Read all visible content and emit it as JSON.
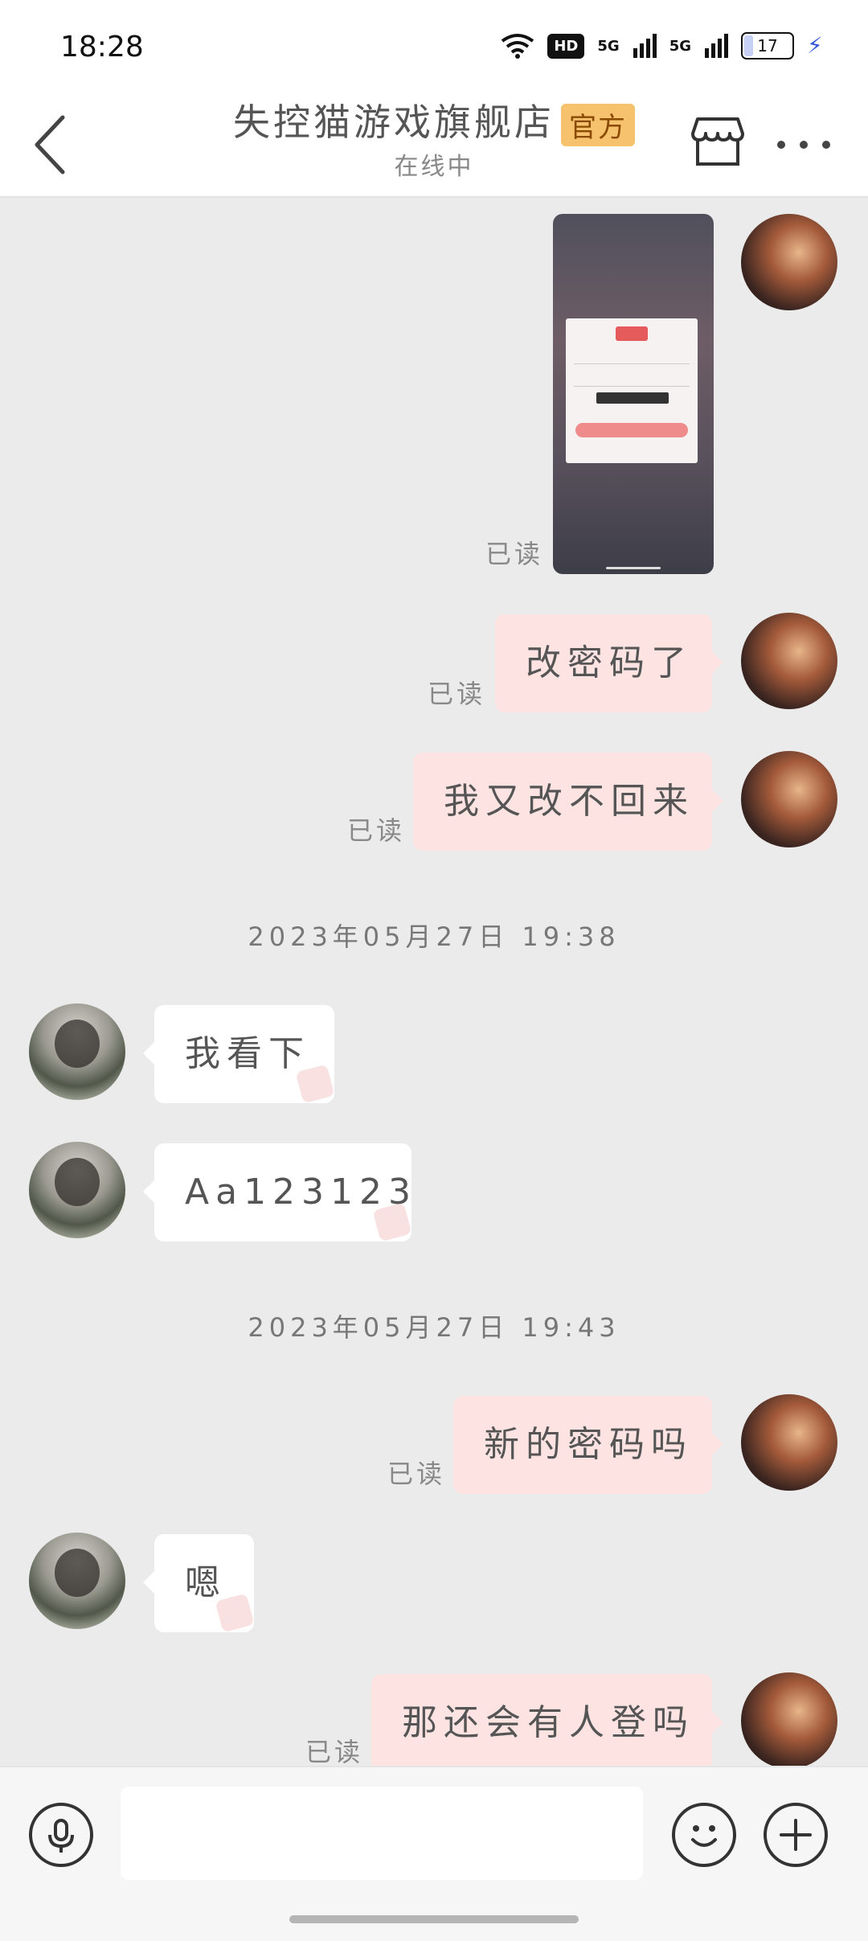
{
  "status_bar": {
    "time": "18:28",
    "hd": "HD",
    "signal1": "5G",
    "signal2": "5G",
    "battery": "17"
  },
  "header": {
    "shop_name": "失控猫游戏旗舰店",
    "official_badge": "官方",
    "status": "在线中"
  },
  "messages": [
    {
      "side": "me",
      "type": "image",
      "read": "已读"
    },
    {
      "side": "me",
      "text": "改密码了",
      "read": "已读"
    },
    {
      "side": "me",
      "text": "我又改不回来",
      "read": "已读"
    },
    {
      "side": "time",
      "text": "2023年05月27日 19:38"
    },
    {
      "side": "them",
      "text": "我看下"
    },
    {
      "side": "them",
      "text": "Aa123123"
    },
    {
      "side": "time",
      "text": "2023年05月27日 19:43"
    },
    {
      "side": "me",
      "text": "新的密码吗",
      "read": "已读"
    },
    {
      "side": "them",
      "text": "嗯"
    },
    {
      "side": "me",
      "text": "那还会有人登吗",
      "read": "已读"
    }
  ],
  "input": {
    "value": "",
    "placeholder": ""
  },
  "colors": {
    "my_bubble": "#fde4e3",
    "their_bubble": "#ffffff",
    "background": "#ebebeb",
    "official_badge": "#f6c26e"
  },
  "icons": {
    "back": "chevron-left-icon",
    "store": "store-icon",
    "more": "more-icon",
    "voice": "microphone-icon",
    "emoji": "smile-icon",
    "plus": "plus-icon"
  }
}
